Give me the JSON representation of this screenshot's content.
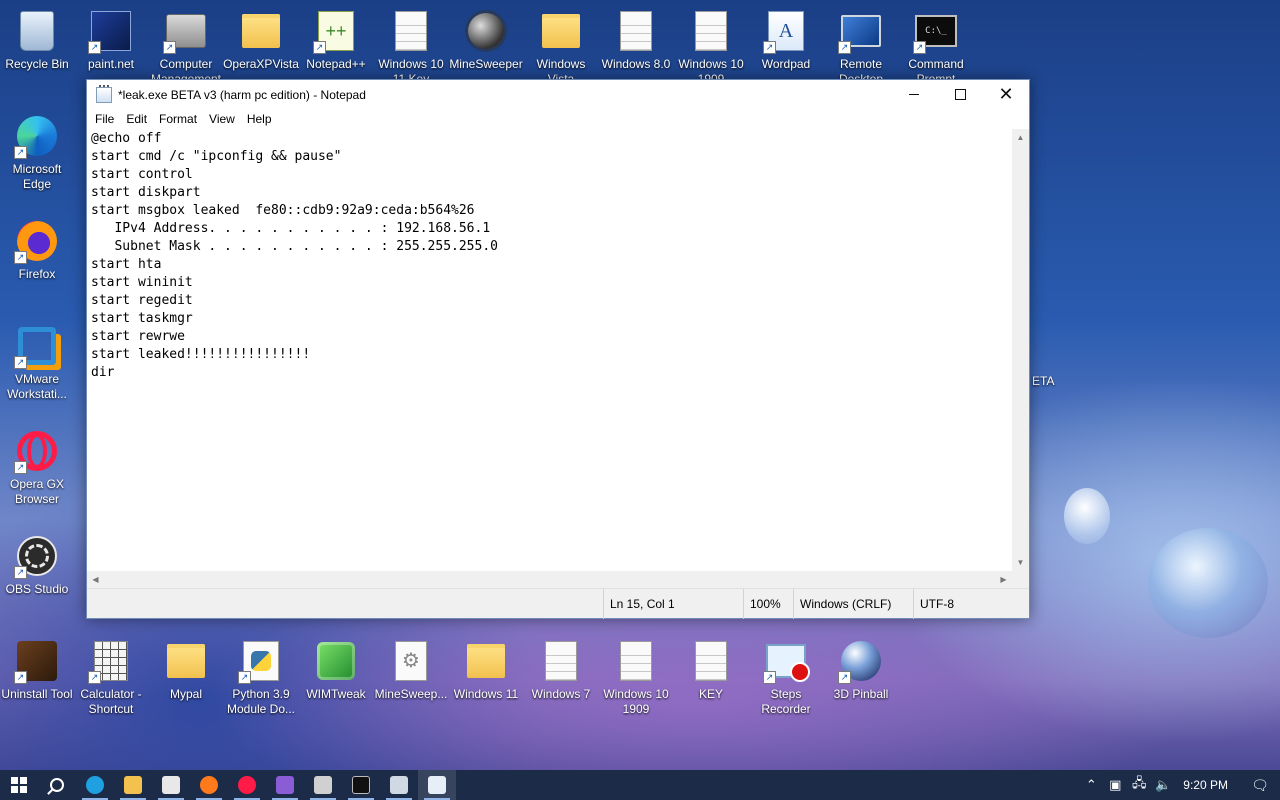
{
  "desktop": {
    "top_row": [
      {
        "label": "Recycle Bin",
        "icon": "recycle-bin-icon",
        "shortcut": false
      },
      {
        "label": "paint.net",
        "icon": "paint-net-icon",
        "shortcut": true
      },
      {
        "label": "Computer Management",
        "icon": "computer-management-icon",
        "shortcut": true
      },
      {
        "label": "OperaXPVista",
        "icon": "folder-icon",
        "shortcut": false
      },
      {
        "label": "Notepad++",
        "icon": "notepad-plus-plus-icon",
        "shortcut": true
      },
      {
        "label": "Windows 10 11 Key",
        "icon": "text-file-icon",
        "shortcut": false
      },
      {
        "label": "MineSweeper",
        "icon": "mine-icon",
        "shortcut": false
      },
      {
        "label": "Windows Vista",
        "icon": "folder-icon",
        "shortcut": false
      },
      {
        "label": "Windows 8.0",
        "icon": "text-file-icon",
        "shortcut": false
      },
      {
        "label": "Windows 10 1909",
        "icon": "text-file-icon",
        "shortcut": false
      },
      {
        "label": "Wordpad",
        "icon": "wordpad-icon",
        "shortcut": true
      },
      {
        "label": "Remote Desktop",
        "icon": "remote-desktop-icon",
        "shortcut": true
      },
      {
        "label": "Command Prompt",
        "icon": "command-prompt-icon",
        "shortcut": true
      }
    ],
    "left_column": [
      {
        "label": "Microsoft Edge",
        "icon": "edge-icon",
        "shortcut": true
      },
      {
        "label": "Firefox",
        "icon": "firefox-icon",
        "shortcut": true
      },
      {
        "label": "VMware Workstati...",
        "icon": "vmware-icon",
        "shortcut": true
      },
      {
        "label": "Opera GX Browser",
        "icon": "opera-gx-icon",
        "shortcut": true
      },
      {
        "label": "OBS Studio",
        "icon": "obs-icon",
        "shortcut": true
      }
    ],
    "bottom_row": [
      {
        "label": "Uninstall Tool",
        "icon": "uninstall-tool-icon",
        "shortcut": true
      },
      {
        "label": "Calculator - Shortcut",
        "icon": "calculator-icon",
        "shortcut": true
      },
      {
        "label": "Mypal",
        "icon": "folder-icon",
        "shortcut": false
      },
      {
        "label": "Python 3.9 Module Do...",
        "icon": "python-icon",
        "shortcut": true
      },
      {
        "label": "WIMTweak",
        "icon": "wimtweak-icon",
        "shortcut": false
      },
      {
        "label": "MineSweep...",
        "icon": "settings-file-icon",
        "shortcut": false
      },
      {
        "label": "Windows 11",
        "icon": "folder-icon",
        "shortcut": false
      },
      {
        "label": "Windows 7",
        "icon": "text-file-icon",
        "shortcut": false
      },
      {
        "label": "Windows 10 1909",
        "icon": "text-file-icon",
        "shortcut": false
      },
      {
        "label": "KEY",
        "icon": "text-file-icon",
        "shortcut": false
      },
      {
        "label": "Steps Recorder",
        "icon": "steps-recorder-icon",
        "shortcut": true
      },
      {
        "label": "3D Pinball",
        "icon": "pinball-icon",
        "shortcut": true
      }
    ],
    "partial_text_right": "ETA"
  },
  "notepad": {
    "title": "*leak.exe BETA v3 (harm pc edition) - Notepad",
    "menu": [
      "File",
      "Edit",
      "Format",
      "View",
      "Help"
    ],
    "content": "@echo off\nstart cmd /c \"ipconfig && pause\"\nstart control\nstart diskpart\nstart msgbox leaked  fe80::cdb9:92a9:ceda:b564%26\n   IPv4 Address. . . . . . . . . . . : 192.168.56.1\n   Subnet Mask . . . . . . . . . . . : 255.255.255.0\nstart hta\nstart wininit\nstart regedit\nstart taskmgr\nstart rewrwe\nstart leaked!!!!!!!!!!!!!!!!\ndir",
    "status": {
      "position": "Ln 15, Col 1",
      "zoom": "100%",
      "line_ending": "Windows (CRLF)",
      "encoding": "UTF-8"
    }
  },
  "taskbar": {
    "apps": [
      {
        "name": "edge",
        "color": "#1fa0e0"
      },
      {
        "name": "file-explorer",
        "color": "#f2c14e"
      },
      {
        "name": "store",
        "color": "#e8e8e8"
      },
      {
        "name": "firefox",
        "color": "#ff7a1a"
      },
      {
        "name": "opera-gx",
        "color": "#ff1b47"
      },
      {
        "name": "visual-studio",
        "color": "#8a5cd6"
      },
      {
        "name": "app-package",
        "color": "#d0d0d0"
      },
      {
        "name": "command-prompt",
        "color": "#111111"
      },
      {
        "name": "window-app",
        "color": "#cfd8e3"
      },
      {
        "name": "notepad",
        "color": "#e6eef8"
      }
    ],
    "clock": "9:20 PM"
  }
}
